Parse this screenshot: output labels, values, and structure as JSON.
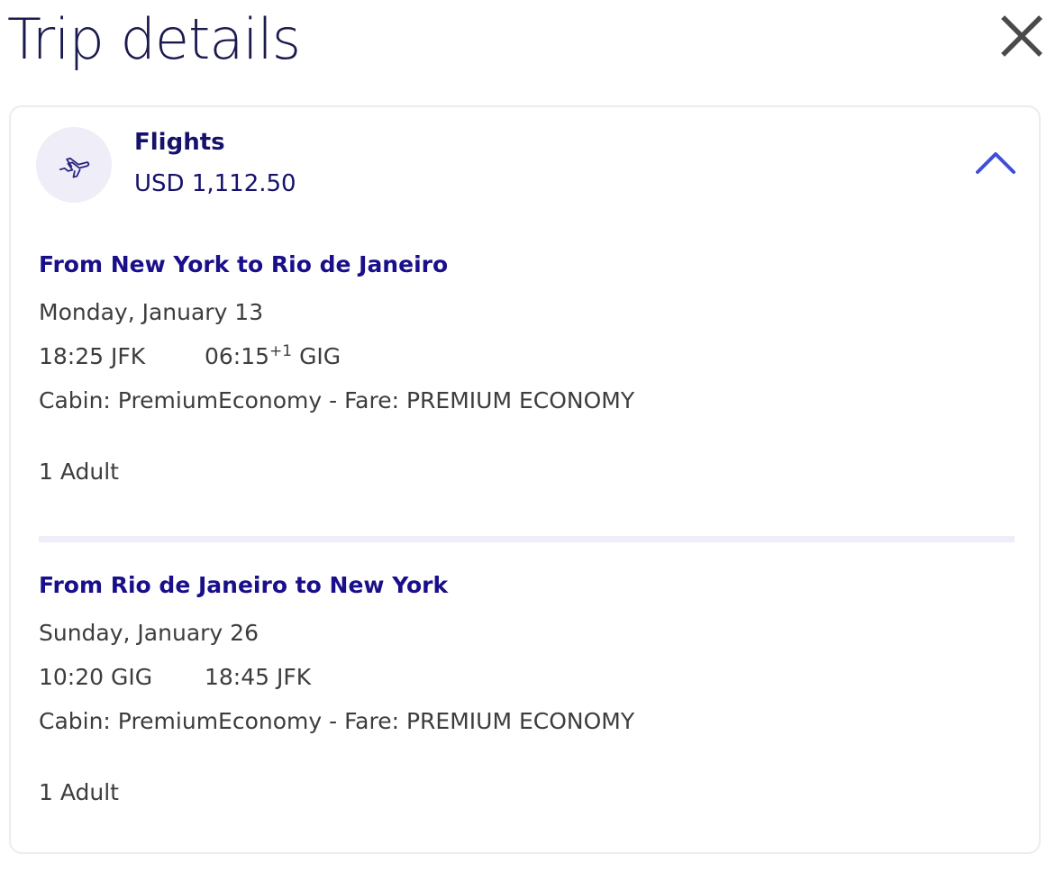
{
  "page": {
    "title": "Trip details",
    "close_icon": "close-icon"
  },
  "card": {
    "icon": "airplane-icon",
    "product_name": "Flights",
    "price": "USD 1,112.50",
    "toggle_icon": "chevron-up-icon",
    "accent_color": "#3f4fd8"
  },
  "legs": [
    {
      "title": "From New York to Rio de Janeiro",
      "date": "Monday, January 13",
      "departure": "18:25 JFK",
      "arrival_time": "06:15",
      "arrival_day_offset": "+1",
      "arrival_airport": "GIG",
      "cabin": "Cabin: PremiumEconomy - Fare: PREMIUM ECONOMY",
      "passengers": "1 Adult"
    },
    {
      "title": "From Rio de Janeiro to New York",
      "date": "Sunday, January 26",
      "departure": "10:20 GIG",
      "arrival": "18:45 JFK",
      "cabin": "Cabin: PremiumEconomy - Fare: PREMIUM ECONOMY",
      "passengers": "1 Adult"
    }
  ]
}
